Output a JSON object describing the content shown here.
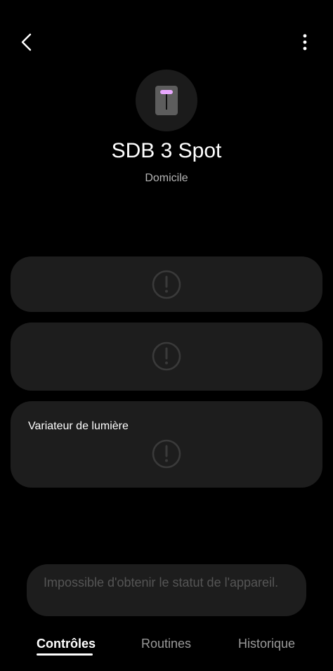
{
  "header": {
    "back_icon": "chevron-left-icon",
    "more_icon": "more-vertical-icon"
  },
  "device": {
    "icon": "spot-light-icon",
    "icon_accent": "#e9a8ff",
    "name": "SDB 3 Spot",
    "location": "Domicile"
  },
  "cards": [
    {
      "label": "",
      "icon": "alert-circle-icon"
    },
    {
      "label": "",
      "icon": "alert-circle-icon"
    },
    {
      "label": "Variateur de lumière",
      "icon": "alert-circle-icon"
    }
  ],
  "status": {
    "message": "Impossible d'obtenir le statut de l'appareil."
  },
  "tabs": [
    {
      "label": "Contrôles",
      "active": true
    },
    {
      "label": "Routines",
      "active": false
    },
    {
      "label": "Historique",
      "active": false
    }
  ],
  "colors": {
    "background": "#000000",
    "card": "#1d1d1d",
    "muted_icon": "#3a3a3a",
    "status_text": "#555555"
  }
}
